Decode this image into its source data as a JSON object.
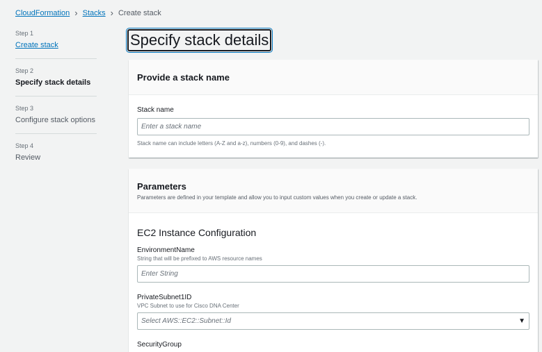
{
  "breadcrumb": {
    "items": [
      "CloudFormation",
      "Stacks"
    ],
    "current": "Create stack"
  },
  "steps": [
    {
      "num": "Step 1",
      "name": "Create stack"
    },
    {
      "num": "Step 2",
      "name": "Specify stack details"
    },
    {
      "num": "Step 3",
      "name": "Configure stack options"
    },
    {
      "num": "Step 4",
      "name": "Review"
    }
  ],
  "page_title": "Specify stack details",
  "stack_name_panel": {
    "header": "Provide a stack name",
    "field_label": "Stack name",
    "placeholder": "Enter a stack name",
    "hint": "Stack name can include letters (A-Z and a-z), numbers (0-9), and dashes (-)."
  },
  "parameters_panel": {
    "header": "Parameters",
    "description": "Parameters are defined in your template and allow you to input custom values when you create or update a stack.",
    "section_title": "EC2 Instance Configuration",
    "fields": [
      {
        "label": "EnvironmentName",
        "hint": "String that will be prefixed to AWS resource names",
        "placeholder": "Enter String"
      },
      {
        "label": "PrivateSubnet1ID",
        "hint": "VPC Subnet to use for Cisco DNA Center",
        "placeholder": "Select AWS::EC2::Subnet::Id"
      }
    ],
    "next_field_label": "SecurityGroup"
  },
  "icons": {
    "breadcrumb_separator": "chevron-right-icon",
    "select_caret": "caret-down-icon"
  },
  "colors": {
    "link": "#0073bb",
    "background": "#f2f3f3",
    "panel": "#ffffff"
  }
}
